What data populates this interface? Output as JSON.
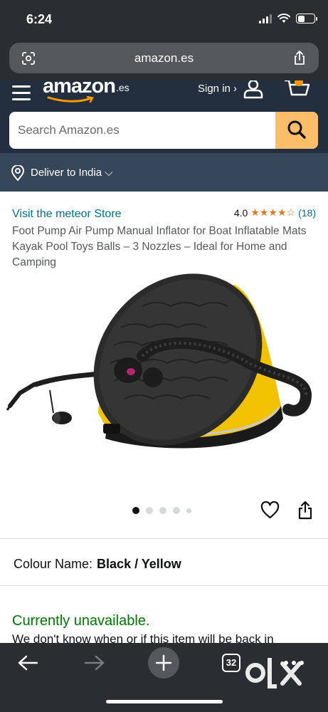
{
  "status_bar": {
    "time": "6:24"
  },
  "browser": {
    "url": "amazon.es",
    "tab_count": "32"
  },
  "header": {
    "logo_text": "amazon",
    "logo_tld": ".es",
    "signin_label": "Sign in ›",
    "search_placeholder": "Search Amazon.es",
    "deliver_label": "Deliver to India ⌵"
  },
  "product": {
    "store_link": "Visit the meteor Store",
    "rating_value": "4.0",
    "rating_stars": 4,
    "rating_count": "(18)",
    "title": "Foot Pump Air Pump Manual Inflator for Boat Inflatable Mats Kayak Pool Toys Balls – 3 Nozzles – Ideal for Home and Camping",
    "image_count": 5,
    "active_image": 1,
    "colour_label": "Colour Name:",
    "colour_value": "Black / Yellow",
    "availability": "Currently unavailable.",
    "availability_desc": "We don't know when or if this item will be back in"
  },
  "watermark": "OLX",
  "colors": {
    "header_bg": "#232f3e",
    "deliver_bg": "#37475a",
    "search_button": "#febd69",
    "link": "#007185",
    "star": "#de7921",
    "unavailable": "#007600"
  }
}
